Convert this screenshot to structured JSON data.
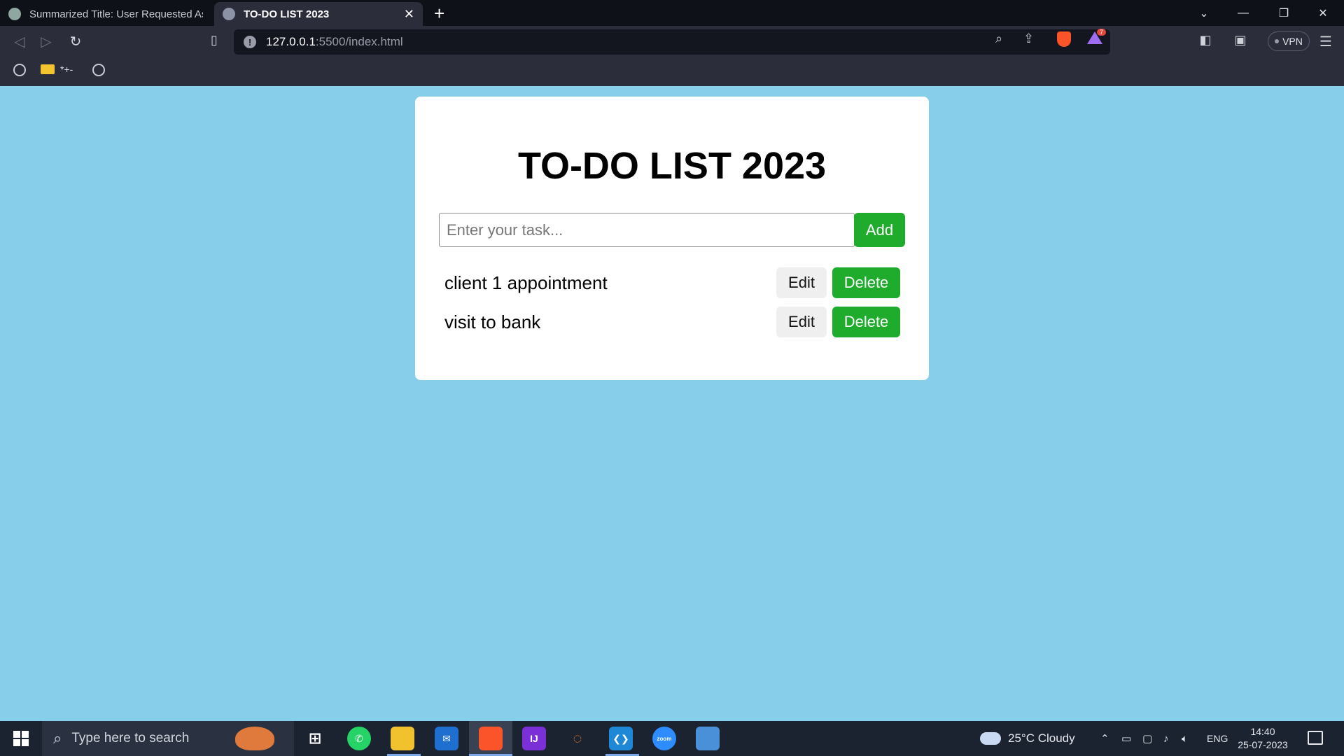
{
  "browser": {
    "tabs": [
      {
        "title": "Summarized Title: User Requested Assistance",
        "active": false
      },
      {
        "title": "TO-DO LIST 2023",
        "active": true
      }
    ],
    "url_host": "127.0.0.1",
    "url_rest": ":5500/index.html",
    "rewards_badge": "7",
    "vpn_label": "VPN",
    "bookmarks": [
      {
        "label": ""
      },
      {
        "label": "*+-"
      },
      {
        "label": ""
      }
    ]
  },
  "page": {
    "heading": "TO-DO LIST 2023",
    "input_placeholder": "Enter your task...",
    "input_value": "",
    "add_label": "Add",
    "tasks": [
      {
        "text": "client 1 appointment",
        "edit_label": "Edit",
        "delete_label": "Delete"
      },
      {
        "text": "visit to bank",
        "edit_label": "Edit",
        "delete_label": "Delete"
      }
    ],
    "colors": {
      "background": "#87CEEB",
      "button_green": "#1fab2c"
    }
  },
  "taskbar": {
    "search_placeholder": "Type here to search",
    "weather": "25°C  Cloudy",
    "language": "ENG",
    "time": "14:40",
    "date": "25-07-2023",
    "icons": [
      "windows-icon",
      "task-view-icon",
      "whatsapp-icon",
      "file-explorer-icon",
      "mail-icon",
      "brave-icon",
      "intellij-icon",
      "jupyter-icon",
      "vscode-icon",
      "zoom-icon",
      "remote-desktop-icon"
    ]
  }
}
